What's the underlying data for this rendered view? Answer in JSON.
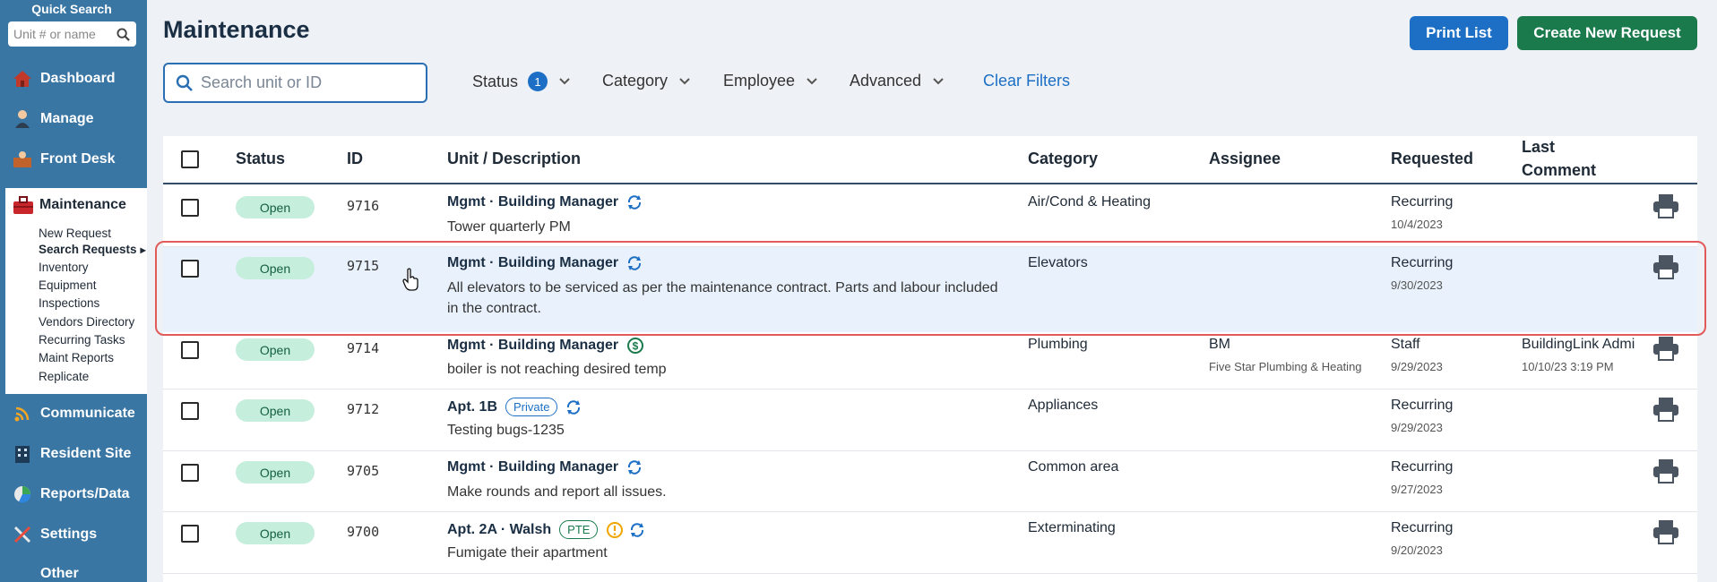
{
  "sidebar": {
    "quick_search_title": "Quick Search",
    "quick_search_placeholder": "Unit # or name",
    "nav": [
      {
        "label": "Dashboard"
      },
      {
        "label": "Manage"
      },
      {
        "label": "Front Desk"
      },
      {
        "label": "Communicate"
      },
      {
        "label": "Resident Site"
      },
      {
        "label": "Reports/Data"
      },
      {
        "label": "Settings"
      },
      {
        "label": "Other"
      }
    ],
    "maintenance": {
      "label": "Maintenance",
      "items": [
        {
          "label": "New Request"
        },
        {
          "label": "Search Requests"
        },
        {
          "label": "Inventory"
        },
        {
          "label": "Equipment"
        },
        {
          "label": "Inspections"
        },
        {
          "label": "Vendors Directory"
        },
        {
          "label": "Recurring Tasks"
        },
        {
          "label": "Maint Reports"
        },
        {
          "label": "Replicate"
        }
      ]
    }
  },
  "header": {
    "title": "Maintenance",
    "print_label": "Print List",
    "create_label": "Create New Request"
  },
  "filters": {
    "search_placeholder": "Search unit or ID",
    "status_label": "Status",
    "status_count": "1",
    "category_label": "Category",
    "employee_label": "Employee",
    "advanced_label": "Advanced",
    "clear_label": "Clear Filters"
  },
  "table": {
    "columns": {
      "status": "Status",
      "id": "ID",
      "unit": "Unit / Description",
      "category": "Category",
      "assignee": "Assignee",
      "requested": "Requested",
      "last_comment_1": "Last",
      "last_comment_2": "Comment"
    },
    "rows": [
      {
        "status": "Open",
        "id": "9716",
        "unit": "Mgmt · Building Manager",
        "desc": "Tower quarterly PM",
        "category": "Air/Cond & Heating",
        "assignee": "",
        "assignee_sub": "",
        "requested": "Recurring",
        "requested_date": "10/4/2023",
        "comment": "",
        "comment_date": ""
      },
      {
        "status": "Open",
        "id": "9715",
        "unit": "Mgmt · Building Manager",
        "desc": "All elevators to be serviced as per the maintenance contract. Parts and labour included in the contract.",
        "category": "Elevators",
        "assignee": "",
        "assignee_sub": "",
        "requested": "Recurring",
        "requested_date": "9/30/2023",
        "comment": "",
        "comment_date": ""
      },
      {
        "status": "Open",
        "id": "9714",
        "unit": "Mgmt · Building Manager",
        "desc": "boiler is not reaching desired temp",
        "category": "Plumbing",
        "assignee": "BM",
        "assignee_sub": "Five Star Plumbing & Heating",
        "requested": "Staff",
        "requested_date": "9/29/2023",
        "comment": "BuildingLink Admi",
        "comment_date": "10/10/23 3:19 PM"
      },
      {
        "status": "Open",
        "id": "9712",
        "unit": "Apt. 1B",
        "tag": "Private",
        "desc": "Testing bugs-1235",
        "category": "Appliances",
        "assignee": "",
        "assignee_sub": "",
        "requested": "Recurring",
        "requested_date": "9/29/2023",
        "comment": "",
        "comment_date": ""
      },
      {
        "status": "Open",
        "id": "9705",
        "unit": "Mgmt · Building Manager",
        "desc": "Make rounds and report all issues.",
        "category": "Common area",
        "assignee": "",
        "assignee_sub": "",
        "requested": "Recurring",
        "requested_date": "9/27/2023",
        "comment": "",
        "comment_date": ""
      },
      {
        "status": "Open",
        "id": "9700",
        "unit": "Apt. 2A · Walsh",
        "tag": "PTE",
        "desc": "Fumigate their apartment",
        "category": "Exterminating",
        "assignee": "",
        "assignee_sub": "",
        "requested": "Recurring",
        "requested_date": "9/20/2023",
        "comment": "",
        "comment_date": ""
      }
    ]
  },
  "colors": {
    "sidebar_bg": "#3a76a4",
    "primary_blue": "#1c6fc4",
    "create_green": "#1a7a4c",
    "status_open_bg": "#c6eedd",
    "highlight_border": "#e25a5a"
  }
}
